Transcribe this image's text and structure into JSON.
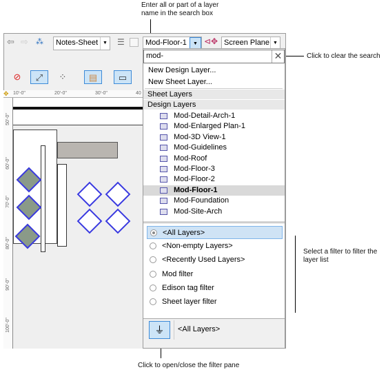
{
  "callouts": {
    "search": "Enter all or part of a layer name in the search box",
    "clear": "Click to clear the search",
    "filter": "Select a filter to filter the layer list",
    "pane": "Click to open/close the filter pane"
  },
  "toolbar": {
    "sheet_select": "Notes-Sheet",
    "layer_select": "Mod-Floor-1",
    "plane_select": "Screen Plane"
  },
  "ruler": {
    "top": [
      "10'-0\"",
      "20'-0\"",
      "30'-0\"",
      "40"
    ],
    "side": [
      "50'-0\"",
      "60'-0\"",
      "70'-0\"",
      "80'-0\"",
      "90'-0\"",
      "100'-0\""
    ]
  },
  "panel": {
    "search_value": "mod-",
    "new_design_layer": "New Design Layer...",
    "new_sheet_layer": "New Sheet Layer...",
    "sheet_layers_header": "Sheet Layers",
    "design_layers_header": "Design Layers",
    "layers": [
      "Mod-Detail-Arch-1",
      "Mod-Enlarged Plan-1",
      "Mod-3D View-1",
      "Mod-Guidelines",
      "Mod-Roof",
      "Mod-Floor-3",
      "Mod-Floor-2",
      "Mod-Floor-1",
      "Mod-Foundation",
      "Mod-Site-Arch"
    ],
    "selected_layer": "Mod-Floor-1",
    "filters": [
      "<All Layers>",
      "<Non-empty Layers>",
      "<Recently Used Layers>",
      "Mod filter",
      "Edison tag filter",
      "Sheet layer filter"
    ],
    "selected_filter": "<All Layers>",
    "current_filter": "<All Layers>"
  },
  "colors": {
    "accent": "#3c8ad8",
    "selection": "#cce4f7"
  }
}
